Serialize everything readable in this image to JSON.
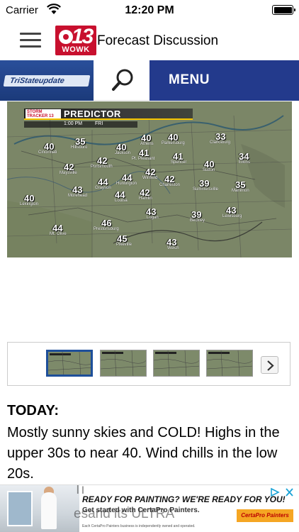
{
  "status_bar": {
    "carrier": "Carrier",
    "time": "12:20 PM"
  },
  "nav": {
    "title": "Forecast Discussion",
    "logo_number": "13",
    "logo_call": "WOWK"
  },
  "header_strip": {
    "left_banner": "TriStateupdate",
    "menu_label": "MENU"
  },
  "map": {
    "title": "PREDICTOR",
    "brand_top": "STORM",
    "brand_bottom": "TRACKER",
    "brand_number": "13",
    "time": "1:00 PM",
    "day": "FRI",
    "readings": [
      {
        "temp": "40",
        "city": "Cincinnati"
      },
      {
        "temp": "35",
        "city": "Hillsboro"
      },
      {
        "temp": "40",
        "city": "Jackson"
      },
      {
        "temp": "40",
        "city": "Athens"
      },
      {
        "temp": "40",
        "city": "Parkersburg"
      },
      {
        "temp": "33",
        "city": "Clarksburg"
      },
      {
        "temp": "41",
        "city": "Pt. Pleasant"
      },
      {
        "temp": "41",
        "city": "Spencer"
      },
      {
        "temp": "42",
        "city": "Portsmouth"
      },
      {
        "temp": "34",
        "city": "Elkins"
      },
      {
        "temp": "42",
        "city": "Maysville"
      },
      {
        "temp": "42",
        "city": "Winfield"
      },
      {
        "temp": "40",
        "city": "Sutton"
      },
      {
        "temp": "44",
        "city": "Huntington"
      },
      {
        "temp": "44",
        "city": "Grayson"
      },
      {
        "temp": "42",
        "city": "Charleston"
      },
      {
        "temp": "43",
        "city": "Morehead"
      },
      {
        "temp": "39",
        "city": "Summersville"
      },
      {
        "temp": "35",
        "city": "Marlinton"
      },
      {
        "temp": "44",
        "city": "Louisa"
      },
      {
        "temp": "42",
        "city": "Hamlin"
      },
      {
        "temp": "40",
        "city": "Lexington"
      },
      {
        "temp": "43",
        "city": "Logan"
      },
      {
        "temp": "43",
        "city": "Lewisburg"
      },
      {
        "temp": "39",
        "city": "Beckley"
      },
      {
        "temp": "46",
        "city": "Prestonsburg"
      },
      {
        "temp": "44",
        "city": "Mt. Olive"
      },
      {
        "temp": "45",
        "city": "Pikeville"
      },
      {
        "temp": "43",
        "city": "Welch"
      }
    ]
  },
  "discussion": {
    "heading": "TODAY:",
    "body": "Mostly sunny skies and COLD!  Highs in the upper 30s to near 40.  Wind chills in the low 20s."
  },
  "ad": {
    "headline": "READY FOR PAINTING? WE'RE READY FOR YOU!",
    "subline": "Get started with CertaPro Painters.",
    "brand": "CertaPro Painters",
    "fine_print": "Each CertaPro Painters business is independently owned and operated.",
    "ghost_top": "Ti",
    "ghost_mid": "esand its ULTRA"
  },
  "colors": {
    "menu_bg": "#233a8c",
    "logo_red": "#c8102e",
    "thumb_active_border": "#1e4f9a",
    "map_bg": "#7a8466"
  }
}
